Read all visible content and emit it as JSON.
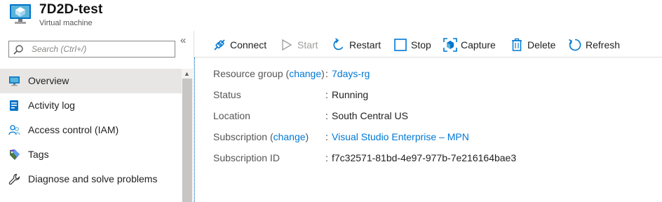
{
  "header": {
    "title": "7D2D-test",
    "subtitle": "Virtual machine",
    "logo_icon": "virtual-machine-icon"
  },
  "sidebar": {
    "search_placeholder": "Search (Ctrl+/)",
    "collapse_label": "«",
    "items": [
      {
        "label": "Overview",
        "icon": "monitor-icon",
        "active": true
      },
      {
        "label": "Activity log",
        "icon": "activity-log-icon",
        "active": false
      },
      {
        "label": "Access control (IAM)",
        "icon": "people-icon",
        "active": false
      },
      {
        "label": "Tags",
        "icon": "tag-icon",
        "active": false
      },
      {
        "label": "Diagnose and solve problems",
        "icon": "wrench-icon",
        "active": false
      }
    ]
  },
  "toolbar": {
    "connect": "Connect",
    "start": "Start",
    "restart": "Restart",
    "stop": "Stop",
    "capture": "Capture",
    "delete": "Delete",
    "refresh": "Refresh"
  },
  "essentials": {
    "resource_group": {
      "key": "Resource group",
      "change": "change",
      "value": "7days-rg"
    },
    "status": {
      "key": "Status",
      "value": "Running"
    },
    "location": {
      "key": "Location",
      "value": "South Central US"
    },
    "subscription": {
      "key": "Subscription",
      "change": "change",
      "value": "Visual Studio Enterprise – MPN"
    },
    "subscription_id": {
      "key": "Subscription ID",
      "value": "f7c32571-81bd-4e97-977b-7e216164bae3"
    }
  },
  "colors": {
    "accent": "#0078d4",
    "active_nav": "#e7e6e5",
    "disabled": "#a19f9d"
  }
}
